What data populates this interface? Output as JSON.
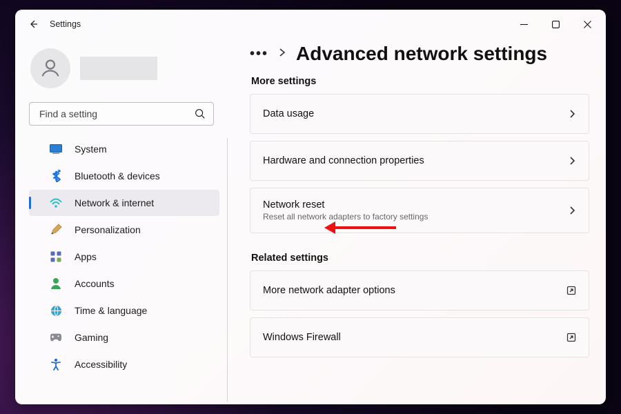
{
  "window": {
    "title": "Settings"
  },
  "search": {
    "placeholder": "Find a setting"
  },
  "sidebar": {
    "items": [
      {
        "label": "System"
      },
      {
        "label": "Bluetooth & devices"
      },
      {
        "label": "Network & internet"
      },
      {
        "label": "Personalization"
      },
      {
        "label": "Apps"
      },
      {
        "label": "Accounts"
      },
      {
        "label": "Time & language"
      },
      {
        "label": "Gaming"
      },
      {
        "label": "Accessibility"
      }
    ],
    "selected_index": 2
  },
  "breadcrumb": {
    "more_glyph": "•••"
  },
  "page": {
    "title": "Advanced network settings"
  },
  "sections": {
    "more_settings": {
      "heading": "More settings",
      "items": [
        {
          "title": "Data usage"
        },
        {
          "title": "Hardware and connection properties"
        },
        {
          "title": "Network reset",
          "subtitle": "Reset all network adapters to factory settings"
        }
      ]
    },
    "related": {
      "heading": "Related settings",
      "items": [
        {
          "title": "More network adapter options"
        },
        {
          "title": "Windows Firewall"
        }
      ]
    }
  }
}
